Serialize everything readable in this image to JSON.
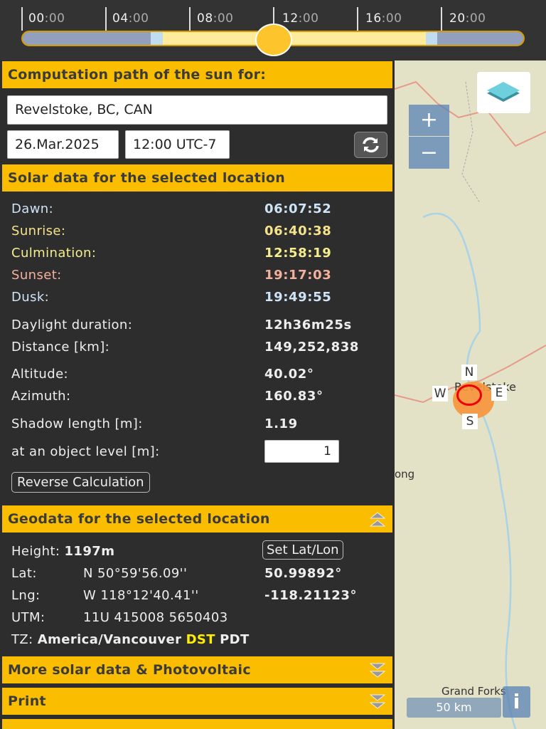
{
  "timeline": {
    "ticks": [
      {
        "h": "00",
        "m": ":00"
      },
      {
        "h": "04",
        "m": ":00"
      },
      {
        "h": "08",
        "m": ":00"
      },
      {
        "h": "12",
        "m": ":00"
      },
      {
        "h": "16",
        "m": ":00"
      },
      {
        "h": "20",
        "m": ":00"
      }
    ],
    "current_hour_fraction": 0.5
  },
  "computation": {
    "title": "Computation path of the sun for:",
    "location": "Revelstoke, BC, CAN",
    "date": "26.Mar.2025",
    "time": "12:00 UTC-7"
  },
  "solar": {
    "title": "Solar data for the selected location",
    "rows": [
      {
        "label": "Dawn:",
        "value": "06:07:52"
      },
      {
        "label": "Sunrise:",
        "value": "06:40:38"
      },
      {
        "label": "Culmination:",
        "value": "12:58:19"
      },
      {
        "label": "Sunset:",
        "value": "19:17:03"
      },
      {
        "label": "Dusk:",
        "value": "19:49:55"
      },
      {
        "label": "Daylight duration:",
        "value": "12h36m25s"
      },
      {
        "label": "Distance [km]:",
        "value": "149,252,838"
      },
      {
        "label": "Altitude:",
        "value": "40.02°"
      },
      {
        "label": "Azimuth:",
        "value": "160.83°"
      },
      {
        "label": "Shadow length [m]:",
        "value": "1.19"
      }
    ],
    "object_level_label": "at an object level [m]:",
    "object_level": "1",
    "reverse_button": "Reverse Calculation"
  },
  "geo": {
    "title": "Geodata for the selected location",
    "height_label": "Height:",
    "height": "1197m",
    "set_button": "Set Lat/Lon",
    "lat_label": "Lat:",
    "lat_dms": "N 50°59'56.09''",
    "lat_dec": "50.99892°",
    "lng_label": "Lng:",
    "lng_dms": "W 118°12'40.41''",
    "lng_dec": "-118.21123°",
    "utm_label": "UTM:",
    "utm": "11U 415008 5650403",
    "tz_label": "TZ:",
    "tz": "America/Vancouver",
    "dst": "DST",
    "tz_abbr": "PDT"
  },
  "sections": {
    "more": "More solar data & Photovoltaic",
    "print": "Print"
  },
  "map": {
    "zoom_in": "+",
    "zoom_out": "−",
    "compass": {
      "n": "N",
      "s": "S",
      "e": "E",
      "w": "W"
    },
    "places": {
      "revelstoke": "Revelstoke",
      "ong": "ong",
      "grand_forks": "Grand Forks"
    },
    "scale": "50 km",
    "info": "i"
  }
}
